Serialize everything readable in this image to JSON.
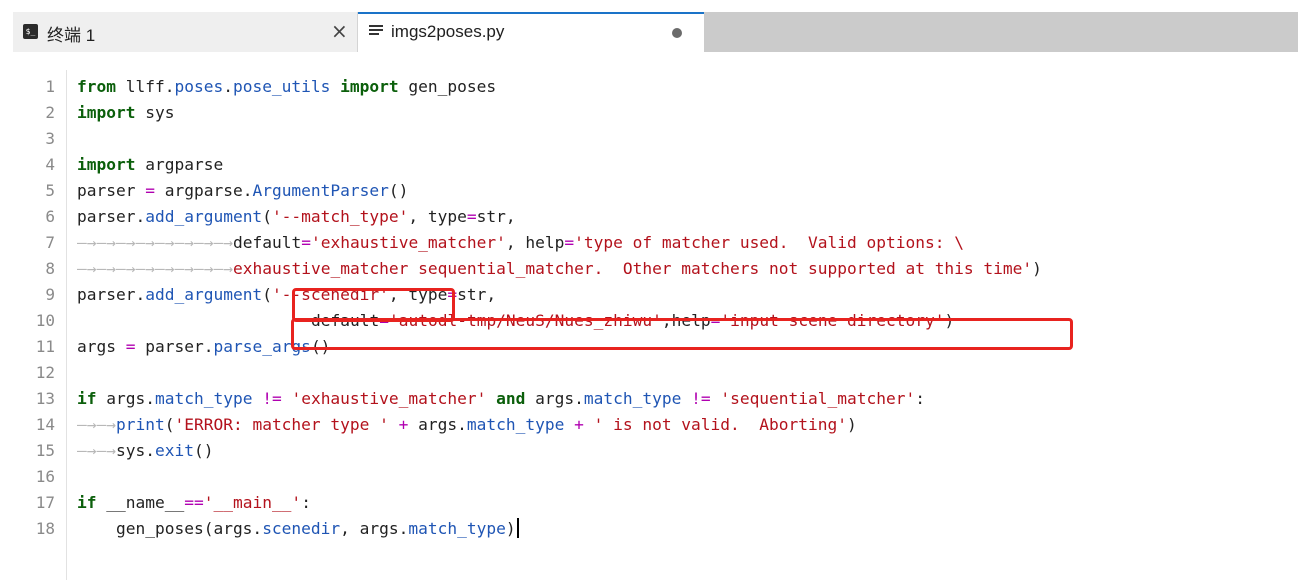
{
  "tabs": [
    {
      "label": "终端 1",
      "icon": "terminal-icon",
      "close_glyph": "×"
    },
    {
      "label": "imgs2poses.py",
      "icon": "file-lines-icon",
      "state": "unsaved",
      "accent": "#1a73c8"
    }
  ],
  "editor": {
    "line_numbers": [
      "1",
      "2",
      "3",
      "4",
      "5",
      "6",
      "7",
      "8",
      "9",
      "10",
      "11",
      "12",
      "13",
      "14",
      "15",
      "16",
      "17",
      "18"
    ],
    "tab_marker": "—→",
    "lines": {
      "l1": {
        "kw1": "from",
        "mod": "llff.",
        "mod2": "poses",
        "mod3": ".",
        "mod4": "pose_utils",
        "kw2": "import",
        "name": "gen_poses"
      },
      "l2": {
        "kw": "import",
        "name": "sys"
      },
      "l4": {
        "kw": "import",
        "name": "argparse"
      },
      "l5": {
        "a": "parser",
        "eq": "=",
        "b": "argparse.",
        "fn": "ArgumentParser",
        "c": "()"
      },
      "l6": {
        "a": "parser.",
        "fn": "add_argument",
        "b": "(",
        "s": "'--match_type'",
        "c": ", type",
        "eq": "=",
        "d": "str,"
      },
      "l7": {
        "a": "default",
        "eq1": "=",
        "s1": "'exhaustive_matcher'",
        "b": ", help",
        "eq2": "=",
        "s2": "'type of matcher used.  Valid options: \\"
      },
      "l8": {
        "s": "exhaustive_matcher sequential_matcher.  Other matchers not supported at this time'",
        "c": ")"
      },
      "l9": {
        "a": "parser.",
        "fn": "add_argument",
        "b": "(",
        "s": "'--scenedir'",
        "c": ", type",
        "eq": "=",
        "d": "str,"
      },
      "l10": {
        "a": "default",
        "eq1": "=",
        "s1": "'autodl-tmp/NeuS/Nues_zhiwu'",
        "b": ",help",
        "eq2": "=",
        "s2": "'input scene directory'",
        "c": ")"
      },
      "l11": {
        "a": "args",
        "eq": "=",
        "b": "parser.",
        "fn": "parse_args",
        "c": "()"
      },
      "l13": {
        "kw1": "if",
        "a": "args.",
        "f1": "match_type",
        "op1": "!=",
        "s1": "'exhaustive_matcher'",
        "kw2": "and",
        "b": "args.",
        "f2": "match_type",
        "op2": "!=",
        "s2": "'sequential_matcher'",
        "c": ":"
      },
      "l14": {
        "fn": "print",
        "a": "(",
        "s1": "'ERROR: matcher type '",
        "op1": "+",
        "b": "args.",
        "f": "match_type",
        "op2": "+",
        "s2": "' is not valid.  Aborting'",
        "c": ")"
      },
      "l15": {
        "a": "sys.",
        "fn": "exit",
        "c": "()"
      },
      "l17": {
        "kw": "if",
        "a": "__name__",
        "op": "==",
        "s": "'__main__'",
        "c": ":"
      },
      "l18": {
        "fn": "gen_poses",
        "a": "(args.",
        "f1": "scenedir",
        "b": ", args.",
        "f2": "match_type",
        "c": ")"
      }
    },
    "highlight_color": "#e8231f"
  }
}
